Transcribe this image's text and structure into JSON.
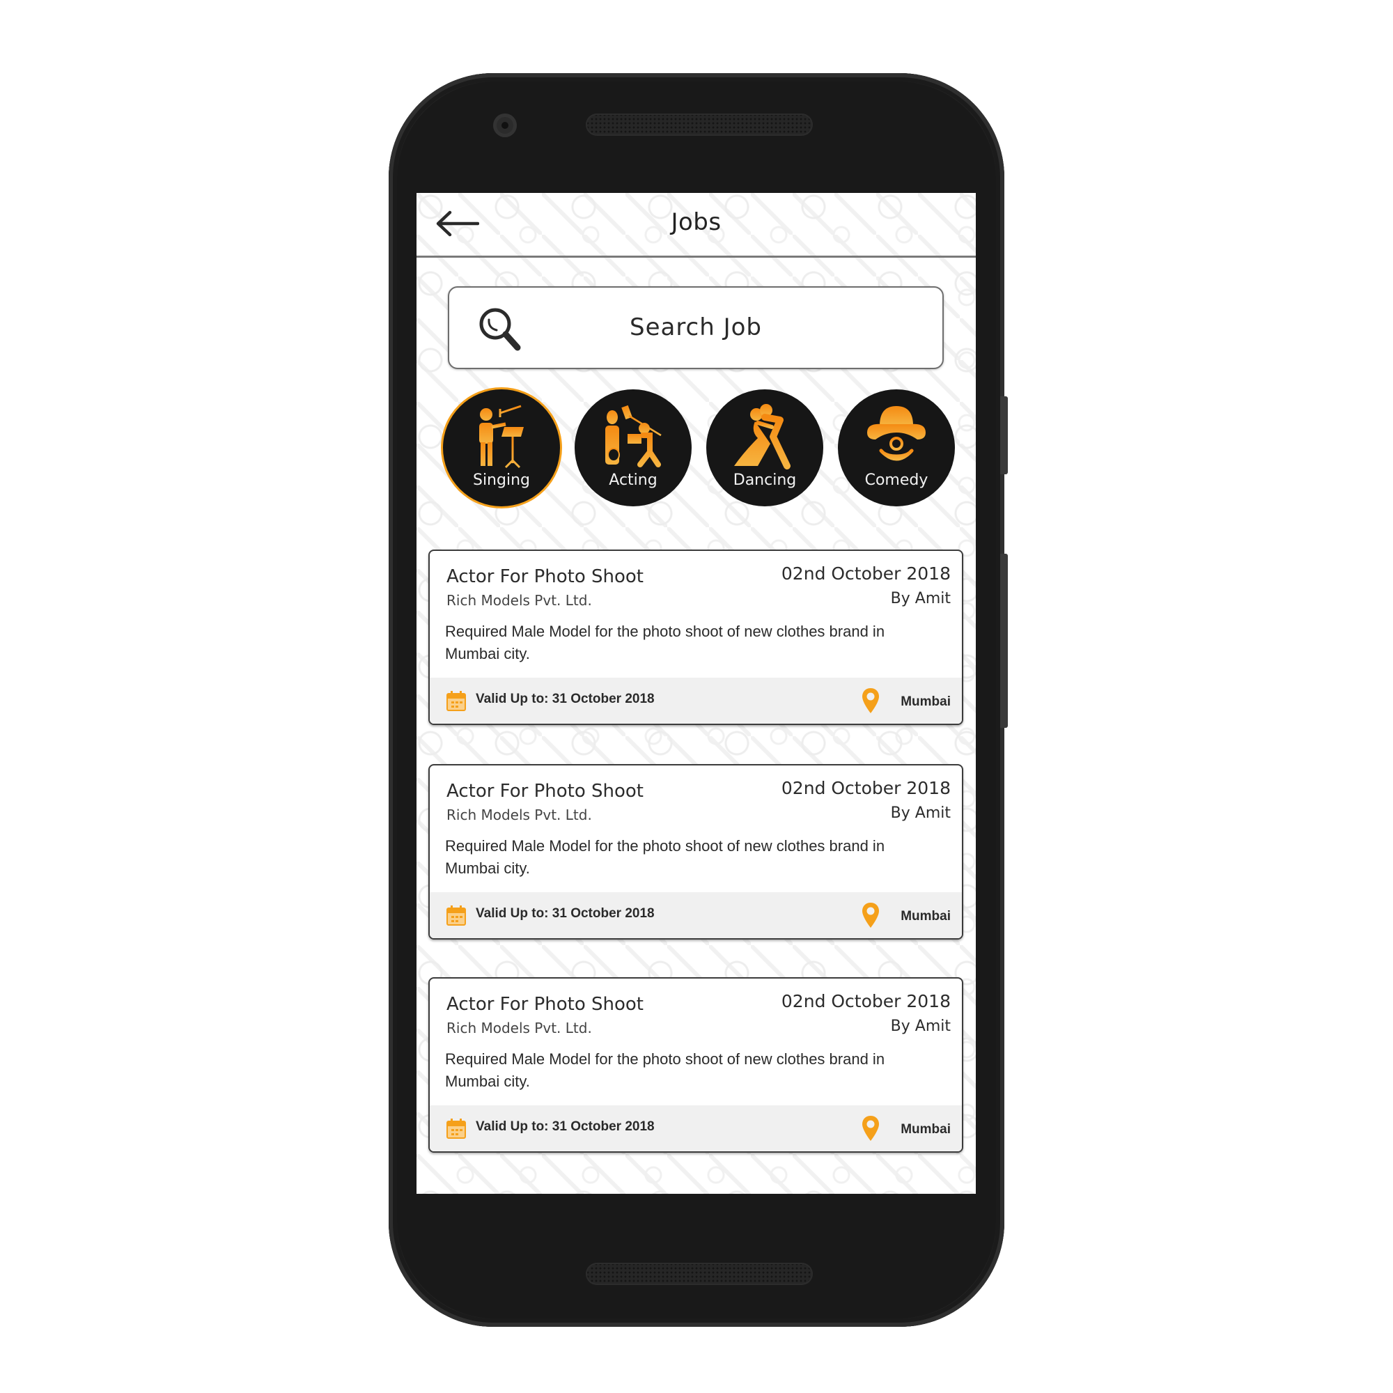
{
  "header": {
    "title": "Jobs",
    "back_icon": "arrow-left-icon"
  },
  "search": {
    "placeholder": "Search Job",
    "icon": "magnifier-icon"
  },
  "categories": [
    {
      "label": "Singing",
      "icon": "singer-microphone-icon",
      "selected": true
    },
    {
      "label": "Acting",
      "icon": "actor-clapperboard-icon",
      "selected": false
    },
    {
      "label": "Dancing",
      "icon": "dancing-couple-icon",
      "selected": false
    },
    {
      "label": "Comedy",
      "icon": "clown-face-icon",
      "selected": false
    }
  ],
  "jobs": [
    {
      "title": "Actor For Photo Shoot",
      "company": "Rich Models Pvt. Ltd.",
      "date": "02nd October 2018",
      "posted_by": "By Amit",
      "description": "Required Male Model for the photo shoot of new clothes brand in Mumbai city.",
      "valid_up_to": "Valid Up to: 31 October 2018",
      "location": "Mumbai"
    },
    {
      "title": "Actor For Photo Shoot",
      "company": "Rich Models Pvt. Ltd.",
      "date": "02nd October 2018",
      "posted_by": "By Amit",
      "description": "Required Male Model for the photo shoot of new clothes brand in Mumbai city.",
      "valid_up_to": "Valid Up to: 31 October 2018",
      "location": "Mumbai"
    },
    {
      "title": "Actor For Photo Shoot",
      "company": "Rich Models Pvt. Ltd.",
      "date": "02nd October 2018",
      "posted_by": "By Amit",
      "description": "Required Male Model for the photo shoot of new clothes brand in Mumbai city.",
      "valid_up_to": "Valid Up to: 31 October 2018",
      "location": "Mumbai"
    }
  ],
  "colors": {
    "accent": "#f5a01a",
    "category_bg": "#161616",
    "card_footer_bg": "#f0f0f0",
    "text_dark": "#2c2c2c"
  }
}
